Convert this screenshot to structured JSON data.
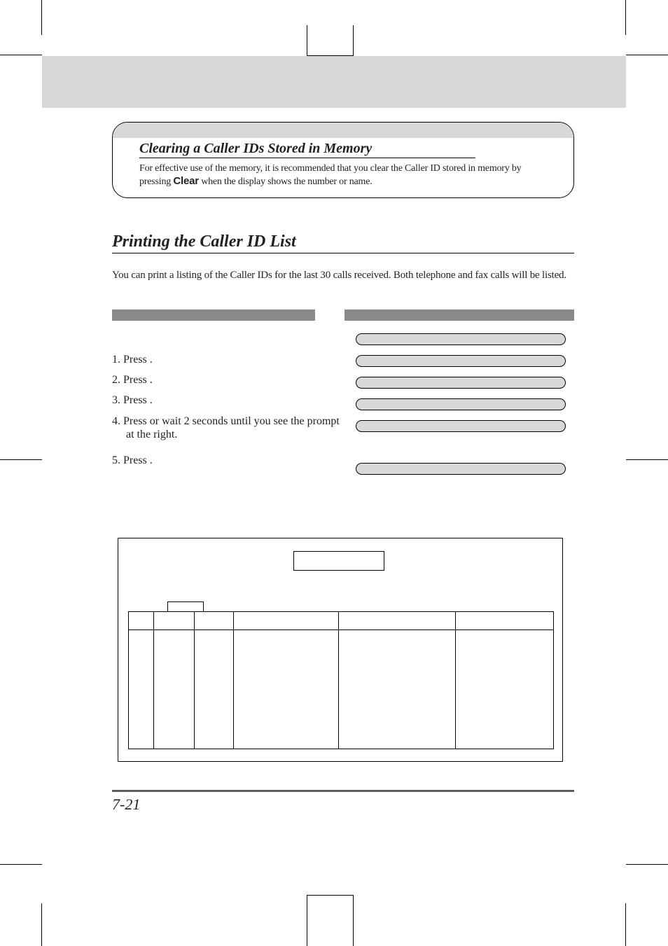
{
  "infobox": {
    "heading": "Clearing a Caller IDs Stored in Memory",
    "text_pre": "For effective use of the memory, it is recommended that you clear the Caller ID stored in memory by pressing ",
    "text_bold": "Clear",
    "text_post": " when the display shows the number or name."
  },
  "section": {
    "title": "Printing the Caller ID List",
    "intro": "You can print a listing of the Caller IDs for the last 30 calls received. Both telephone and fax calls will be listed."
  },
  "steps": [
    {
      "num": "1.",
      "pre": " Press ",
      "key": "",
      "post": "."
    },
    {
      "num": "2.",
      "pre": " Press ",
      "key": "",
      "post": "."
    },
    {
      "num": "3.",
      "pre": " Press ",
      "key": "",
      "post": "."
    },
    {
      "num": "4.",
      "pre": " Press ",
      "key": "",
      "post": " or wait 2 seconds until you see the prompt at the right."
    },
    {
      "num": "5.",
      "pre": " Press ",
      "key": "",
      "post": "."
    }
  ],
  "page_number": "7-21"
}
